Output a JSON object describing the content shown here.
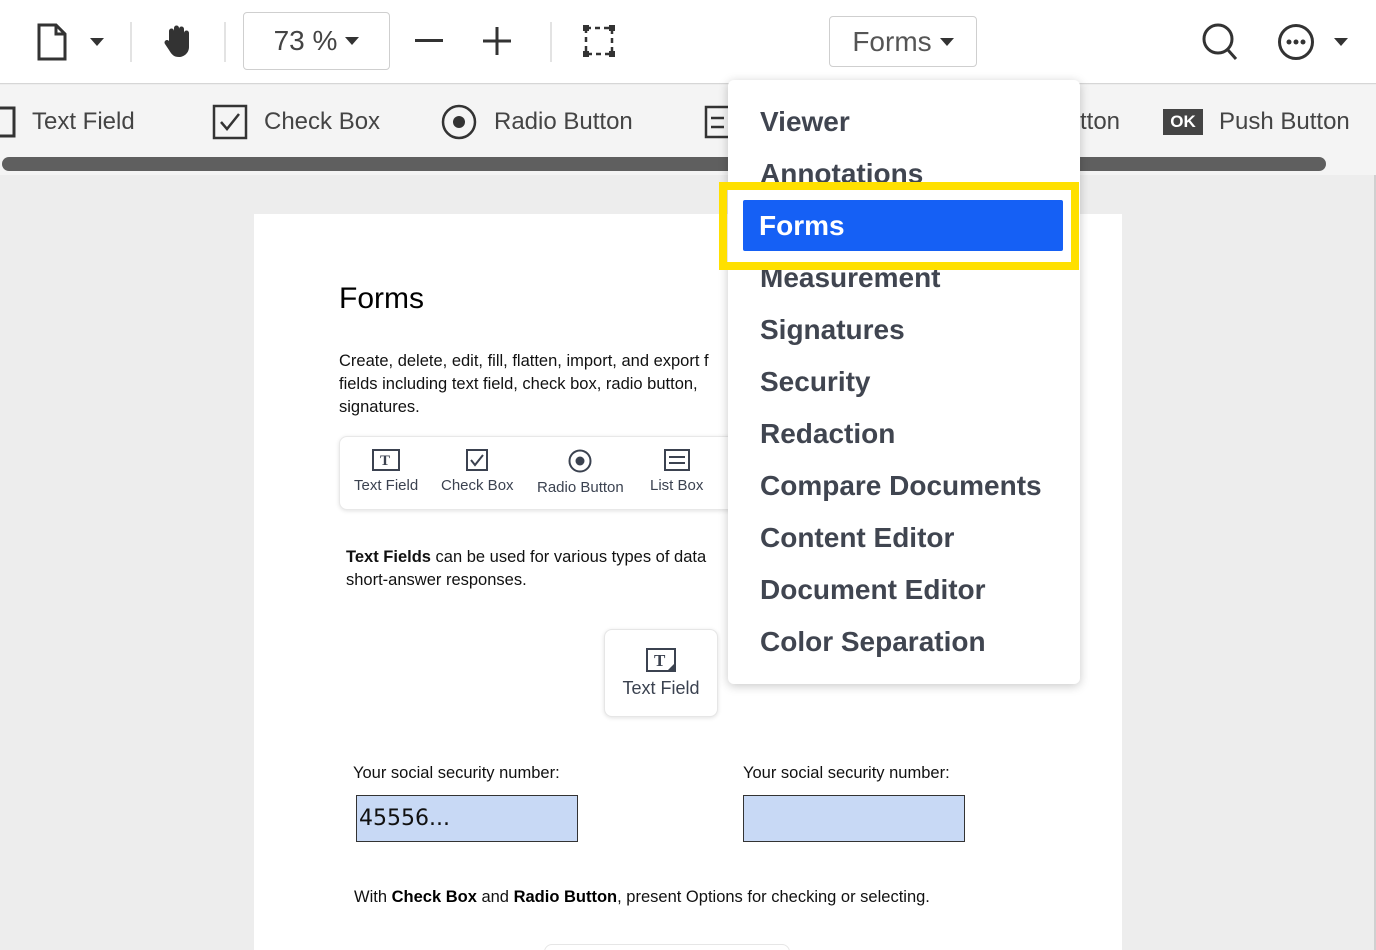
{
  "toolbar": {
    "zoom_value": "73 %",
    "mode_label": "Forms",
    "icons": [
      "file-icon",
      "pan-hand-icon",
      "zoom-out-icon",
      "zoom-in-icon",
      "marquee-select-icon",
      "search-icon",
      "more-options-icon"
    ]
  },
  "form_tools": {
    "text_field": "Text Field",
    "check_box": "Check Box",
    "radio_button": "Radio Button",
    "partial_button": "tton",
    "push_button_badge": "OK",
    "push_button": "Push Button"
  },
  "dropdown": {
    "items": [
      "Viewer",
      "Annotations",
      "Forms",
      "Measurement",
      "Signatures",
      "Security",
      "Redaction",
      "Compare Documents",
      "Content Editor",
      "Document Editor",
      "Color Separation"
    ],
    "selected": "Forms",
    "highlight_color": "#ffe000",
    "selected_color": "#1560f5"
  },
  "document": {
    "title": "Forms",
    "intro_lines": [
      "Create, delete, edit, fill, flatten, import, and export f",
      "fields including text field, check box, radio button,",
      "signatures."
    ],
    "sample_tools": [
      "Text Field",
      "Check Box",
      "Radio Button",
      "List Box"
    ],
    "text_fields_bold": "Text Fields",
    "text_fields_line1": " can be used for various types of data",
    "text_fields_line2": "short-answer responses.",
    "text_field_card_label": "Text Field",
    "ssn_label_left": "Your social security number:",
    "ssn_label_right": "Your social security number:",
    "ssn_value_left": "45556...",
    "ssn_value_right": "",
    "cb_prefix": "With ",
    "cb_bold1": "Check Box",
    "cb_mid": " and ",
    "cb_bold2": "Radio Button",
    "cb_suffix": ", present Options for checking or selecting."
  }
}
